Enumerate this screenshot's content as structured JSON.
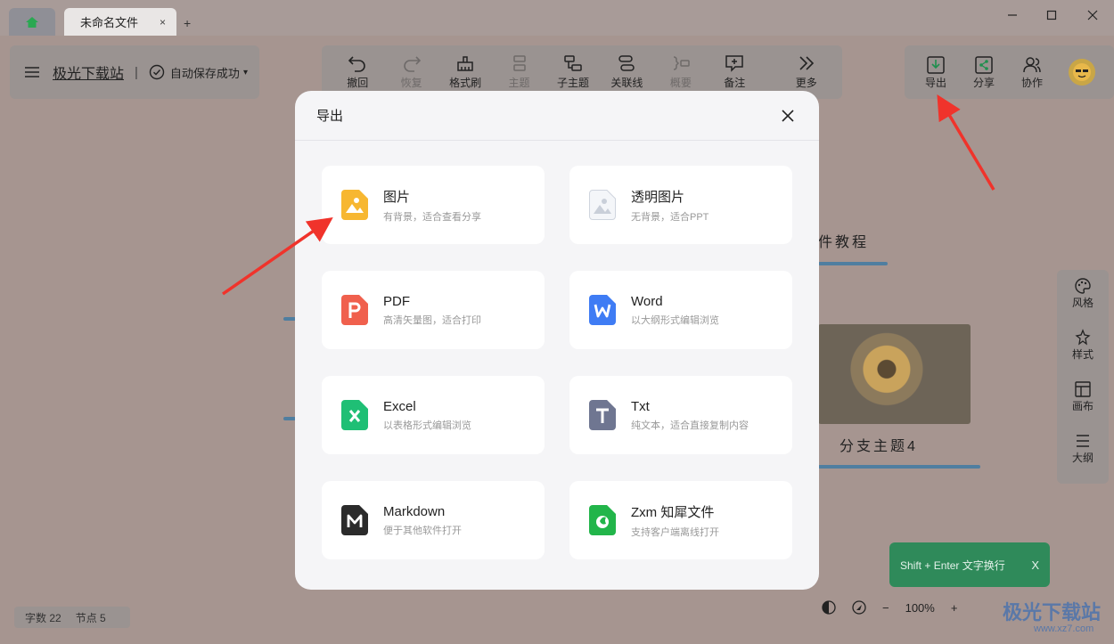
{
  "titlebar": {
    "tab_title": "未命名文件",
    "tab_close": "×",
    "new_tab": "+",
    "minimize": "—",
    "maximize": "☐",
    "close": "✕"
  },
  "header": {
    "brand": "极光下载站",
    "separator": "|",
    "save_status": "自动保存成功",
    "save_caret": "▾"
  },
  "toolbar": {
    "items": [
      {
        "label": "撤回",
        "icon": "undo-icon",
        "enabled": true
      },
      {
        "label": "恢复",
        "icon": "redo-icon",
        "enabled": false
      },
      {
        "label": "格式刷",
        "icon": "format-painter-icon",
        "enabled": true
      },
      {
        "label": "主题",
        "icon": "topic-icon",
        "enabled": false
      },
      {
        "label": "子主题",
        "icon": "subtopic-icon",
        "enabled": true
      },
      {
        "label": "关联线",
        "icon": "relation-line-icon",
        "enabled": true
      },
      {
        "label": "概要",
        "icon": "summary-icon",
        "enabled": false
      },
      {
        "label": "备注",
        "icon": "note-icon",
        "enabled": true
      },
      {
        "label": "更多",
        "icon": "more-icon",
        "enabled": true
      }
    ]
  },
  "right_toolbar": {
    "export": "导出",
    "share": "分享",
    "collab": "协作"
  },
  "side_toolbar": {
    "items": [
      "风格",
      "样式",
      "画布",
      "大纲"
    ]
  },
  "canvas": {
    "text_1": "件教程",
    "text_2": "分支主题4"
  },
  "status": {
    "word_count": "字数 22",
    "node_count": "节点 5"
  },
  "zoom": {
    "minus": "−",
    "level": "100%",
    "plus": "+"
  },
  "toast": {
    "text": "Shift + Enter 文字换行",
    "close": "X"
  },
  "watermark": {
    "text": "极光下载站",
    "sub": "www.xz7.com"
  },
  "modal": {
    "title": "导出",
    "options": [
      {
        "title": "图片",
        "desc": "有背景，适合查看分享",
        "icon": "image-icon",
        "color": "#f7b731"
      },
      {
        "title": "透明图片",
        "desc": "无背景，适合PPT",
        "icon": "transparent-image-icon",
        "color": "#d8dde6"
      },
      {
        "title": "PDF",
        "desc": "高清矢量图，适合打印",
        "icon": "pdf-icon",
        "color": "#f0604d"
      },
      {
        "title": "Word",
        "desc": "以大纲形式编辑浏览",
        "icon": "word-icon",
        "color": "#3f7cf4"
      },
      {
        "title": "Excel",
        "desc": "以表格形式编辑浏览",
        "icon": "excel-icon",
        "color": "#1fbf75"
      },
      {
        "title": "Txt",
        "desc": "纯文本，适合直接复制内容",
        "icon": "txt-icon",
        "color": "#6f7691"
      },
      {
        "title": "Markdown",
        "desc": "便于其他软件打开",
        "icon": "markdown-icon",
        "color": "#2b2b2b"
      },
      {
        "title": "Zxm 知犀文件",
        "desc": "支持客户端离线打开",
        "icon": "zxm-file-icon",
        "color": "#22b54a"
      }
    ]
  },
  "colors": {
    "overlay_bg": "#a69590",
    "modal_bg": "#f5f5f7",
    "arrow": "#f0332b"
  }
}
